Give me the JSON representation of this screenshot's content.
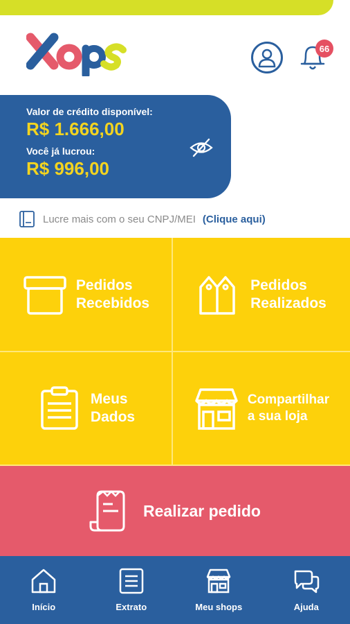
{
  "brand": {
    "logo_text": "Xops",
    "accent": "#d6df27",
    "blue": "#2a5f9e",
    "yellow": "#fdd10b",
    "red": "#e55a6b"
  },
  "header": {
    "notifications_count": "66"
  },
  "credit": {
    "available_label": "Valor de crédito disponível:",
    "available_value": "R$ 1.666,00",
    "profit_label": "Você já lucrou:",
    "profit_value": "R$ 996,00",
    "toggle_icon": "eye-off-icon"
  },
  "cnpj": {
    "text": "Lucre mais com o seu CNPJ/MEI",
    "link": "(Clique aqui)"
  },
  "tiles": [
    {
      "label": "Pedidos\nRecebidos",
      "icon": "box-icon"
    },
    {
      "label": "Pedidos\nRealizados",
      "icon": "tags-icon"
    },
    {
      "label": "Meus\nDados",
      "icon": "clipboard-icon"
    },
    {
      "label": "Compartilhar\na sua loja",
      "icon": "store-icon"
    }
  ],
  "order": {
    "label": "Realizar pedido",
    "icon": "receipt-icon"
  },
  "nav": [
    {
      "label": "Início",
      "icon": "home-icon"
    },
    {
      "label": "Extrato",
      "icon": "statement-icon"
    },
    {
      "label": "Meu shops",
      "icon": "shop-icon"
    },
    {
      "label": "Ajuda",
      "icon": "chat-icon"
    }
  ]
}
